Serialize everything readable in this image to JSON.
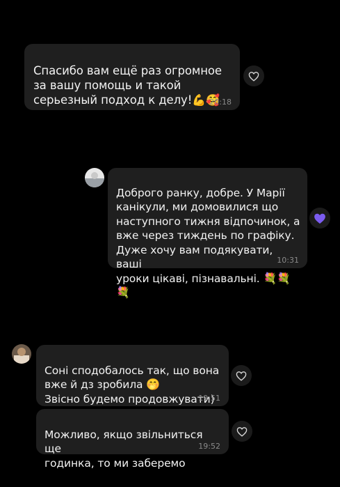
{
  "messages": [
    {
      "text": "Спасибо вам ещё раз огромное\nза вашу помощь и такой\nсерьезный подход к делу!",
      "emoji": "💪🥰",
      "time": "20:18",
      "reaction": "heart-outline-icon"
    },
    {
      "text": "Доброго ранку, добре. У Марії\nканікули, ми домовилися що\nнаступного тижня відпочинок, а\nвже через тиждень по графіку.\nДуже хочу вам подякувати, ваші\nуроки цікаві, пізнавальні.",
      "emoji": "💐💐💐",
      "time": "10:31",
      "reaction": "purple-heart-icon"
    },
    {
      "text": "Соні сподобалось так, що вона\nвже й дз зробила",
      "emoji": "🤭",
      "text2": "Звісно будемо продовжувати)",
      "time": "19:51",
      "reaction": "heart-outline-icon"
    },
    {
      "text": "Можливо, якщо звільниться ще\nгодинка, то ми заберемо",
      "time": "19:52",
      "reaction": "heart-outline-icon"
    }
  ],
  "colors": {
    "background": "#000000",
    "bubble": "#1f1f1f",
    "text": "#f2f2f2",
    "time": "#8a8a8a",
    "reaction_purple": "#7b5cf0"
  }
}
